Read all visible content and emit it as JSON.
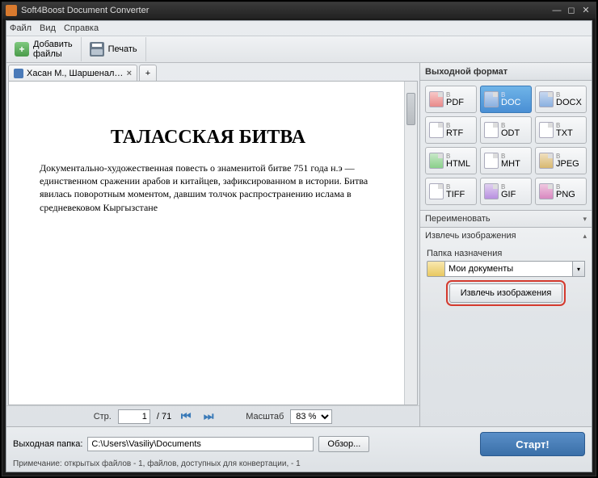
{
  "window": {
    "title": "Soft4Boost Document Converter"
  },
  "menu": {
    "file": "Файл",
    "view": "Вид",
    "help": "Справка"
  },
  "toolbar": {
    "add": "Добавить\nфайлы",
    "print": "Печать"
  },
  "tab": {
    "label": "Хасан М., Шаршеналиев ...",
    "add": "+"
  },
  "doc": {
    "title": "ТАЛАССКАЯ БИТВА",
    "para": "Документально-художественная повесть о знаменитой битве 751 года н.э — единственном сражении арабов и китайцев, зафиксированном в истории. Битва явилась поворотным моментом, давшим толчок распространению ислама в средневековом Кыргызстане"
  },
  "pager": {
    "page_lbl": "Стр.",
    "page": "1",
    "total": "/ 71",
    "zoom_lbl": "Масштаб",
    "zoom": "83 %"
  },
  "right": {
    "header": "Выходной формат",
    "to": "В",
    "formats": [
      "PDF",
      "DOC",
      "DOCX",
      "RTF",
      "ODT",
      "TXT",
      "HTML",
      "MHT",
      "JPEG",
      "TIFF",
      "GIF",
      "PNG"
    ],
    "selected": "DOC",
    "rename": "Переименовать",
    "extract": "Извлечь изображения",
    "dest_lbl": "Папка назначения",
    "dest_val": "Мои документы",
    "extract_btn": "Извлечь изображения"
  },
  "bottom": {
    "out_lbl": "Выходная папка:",
    "out_val": "C:\\Users\\Vasiliy\\Documents",
    "browse": "Обзор...",
    "start": "Старт!",
    "note": "Примечание: открытых файлов - 1, файлов, доступных для конвертации, - 1"
  }
}
